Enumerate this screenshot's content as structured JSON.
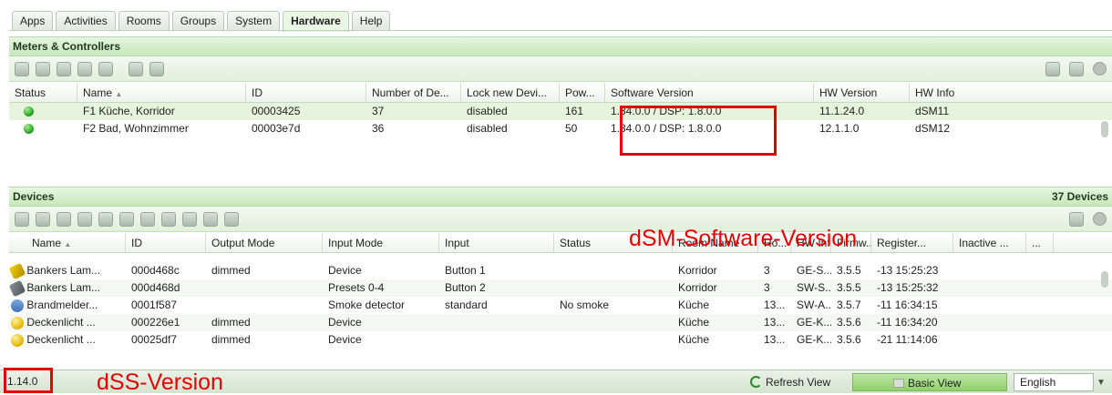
{
  "tabs": [
    {
      "label": "Apps"
    },
    {
      "label": "Activities"
    },
    {
      "label": "Rooms"
    },
    {
      "label": "Groups"
    },
    {
      "label": "System"
    },
    {
      "label": "Hardware",
      "active": true
    },
    {
      "label": "Help"
    }
  ],
  "meters": {
    "title": "Meters & Controllers",
    "columns": [
      "Status",
      "Name",
      "ID",
      "Number of De...",
      "Lock new Devi...",
      "Pow...",
      "Software Version",
      "HW Version",
      "HW Info"
    ],
    "sort_indicator": "▲",
    "rows": [
      {
        "status": "online",
        "name": "F1 Küche, Korridor",
        "id": "00003425",
        "num_devices": "37",
        "lock": "disabled",
        "power": "161",
        "software": "1.34.0.0 / DSP: 1.8.0.0",
        "hw_version": "11.1.24.0",
        "hw_info": "dSM11"
      },
      {
        "status": "online",
        "name": "F2 Bad, Wohnzimmer",
        "id": "00003e7d",
        "num_devices": "36",
        "lock": "disabled",
        "power": "50",
        "software": "1.34.0.0 / DSP: 1.8.0.0",
        "hw_version": "12.1.1.0",
        "hw_info": "dSM12"
      }
    ]
  },
  "devices": {
    "title": "Devices",
    "count": "37 Devices",
    "columns": [
      "Name",
      "ID",
      "Output Mode",
      "Input Mode",
      "Input",
      "Status",
      "Room Name",
      "Ro...",
      "HW Info",
      "Firmw...",
      "Register...",
      "Inactive ...",
      "..."
    ],
    "sort_indicator": "▲",
    "rows": [
      {
        "icon": "wand-icon",
        "name": "Bankers Lam...",
        "id": "000d468c",
        "output": "dimmed",
        "input_mode": "Device",
        "input": "Button 1",
        "status": "",
        "room": "Korridor",
        "ro": "3",
        "hw": "GE-S...",
        "fw": "3.5.5",
        "reg": "-13 15:25:23",
        "inactive": ""
      },
      {
        "icon": "brush-icon",
        "name": "Bankers Lam...",
        "id": "000d468d",
        "output": "",
        "input_mode": "Presets 0-4",
        "input": "Button 2",
        "status": "",
        "room": "Korridor",
        "ro": "3",
        "hw": "SW-S...",
        "fw": "3.5.5",
        "reg": "-13 15:25:32",
        "inactive": ""
      },
      {
        "icon": "smoke-detector-icon",
        "name": "Brandmelder...",
        "id": "0001f587",
        "output": "",
        "input_mode": "Smoke detector",
        "input": "standard",
        "status": "No smoke",
        "room": "Küche",
        "ro": "13...",
        "hw": "SW-A...",
        "fw": "3.5.7",
        "reg": "-11 16:34:15",
        "inactive": ""
      },
      {
        "icon": "light-icon",
        "name": "Deckenlicht ...",
        "id": "000226e1",
        "output": "dimmed",
        "input_mode": "Device",
        "input": "",
        "status": "",
        "room": "Küche",
        "ro": "13...",
        "hw": "GE-K...",
        "fw": "3.5.6",
        "reg": "-11 16:34:20",
        "inactive": ""
      },
      {
        "icon": "light-icon",
        "name": "Deckenlicht ...",
        "id": "00025df7",
        "output": "dimmed",
        "input_mode": "Device",
        "input": "",
        "status": "",
        "room": "Küche",
        "ro": "13...",
        "hw": "GE-K...",
        "fw": "3.5.6",
        "reg": "-21 11:14:06",
        "inactive": ""
      }
    ]
  },
  "annotations": {
    "dsm": "dSM-Software-Version",
    "dss": "dSS-Version"
  },
  "statusbar": {
    "version": "1.14.0",
    "refresh": "Refresh View",
    "basic": "Basic View",
    "language": "English"
  },
  "colors": {
    "accent_green": "#8fd06a",
    "annotation_red": "#e60000"
  }
}
